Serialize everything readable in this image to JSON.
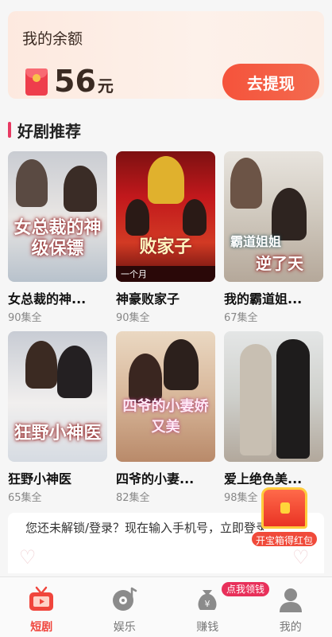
{
  "balance": {
    "label": "我的余额",
    "amount": "56",
    "unit": "元",
    "withdraw_label": "去提现"
  },
  "section": {
    "title": "好剧推荐"
  },
  "dramas": [
    {
      "name": "女总裁的神...",
      "count": "90集全",
      "poster_text": "女总裁的神级保镖"
    },
    {
      "name": "神豪败家子",
      "count": "90集全",
      "poster_text": "败家子",
      "poster_band": "一个月"
    },
    {
      "name": "我的霸道姐...",
      "count": "67集全",
      "poster_text": "逆了天",
      "poster_sub": "霸道姐姐"
    },
    {
      "name": "狂野小神医",
      "count": "65集全",
      "poster_text": "狂野小神医"
    },
    {
      "name": "四爷的小妻...",
      "count": "82集全",
      "poster_text": "四爷的小妻娇又美"
    },
    {
      "name": "爱上绝色美...",
      "count": "98集全"
    }
  ],
  "login_banner": {
    "text": "您还未解锁/登录？现在输入手机号，立即登录"
  },
  "treasure": {
    "label": "开宝箱得红包"
  },
  "nav": {
    "items": [
      {
        "label": "短剧",
        "icon": "tv-icon",
        "active": true
      },
      {
        "label": "娱乐",
        "icon": "music-disc-icon",
        "active": false
      },
      {
        "label": "赚钱",
        "icon": "money-bag-icon",
        "active": false,
        "badge": "点我领钱"
      },
      {
        "label": "我的",
        "icon": "user-icon",
        "active": false
      }
    ]
  },
  "colors": {
    "accent": "#f0453c",
    "section_bar": "#e83a63",
    "badge": "#e8305a"
  }
}
